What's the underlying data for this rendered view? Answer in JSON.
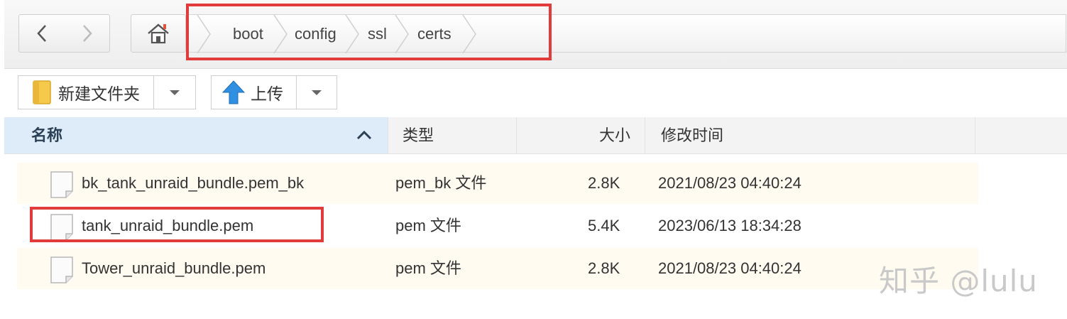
{
  "breadcrumb": [
    "boot",
    "config",
    "ssl",
    "certs"
  ],
  "toolbar": {
    "new_folder_label": "新建文件夹",
    "upload_label": "上传"
  },
  "columns": {
    "name": "名称",
    "type": "类型",
    "size": "大小",
    "modified": "修改时间"
  },
  "files": [
    {
      "name": "bk_tank_unraid_bundle.pem_bk",
      "type": "pem_bk 文件",
      "size": "2.8K",
      "modified": "2021/08/23 04:40:24"
    },
    {
      "name": "tank_unraid_bundle.pem",
      "type": "pem 文件",
      "size": "5.4K",
      "modified": "2023/06/13 18:34:28"
    },
    {
      "name": "Tower_unraid_bundle.pem",
      "type": "pem 文件",
      "size": "2.8K",
      "modified": "2021/08/23 04:40:24"
    }
  ],
  "watermark": "知乎 @lulu",
  "colors": {
    "highlight": "#e23b3b",
    "header_selected": "#ddecf8",
    "row_alt": "#fffbf1",
    "upload_arrow": "#2f8fe0",
    "folder": "#f5c94a"
  }
}
